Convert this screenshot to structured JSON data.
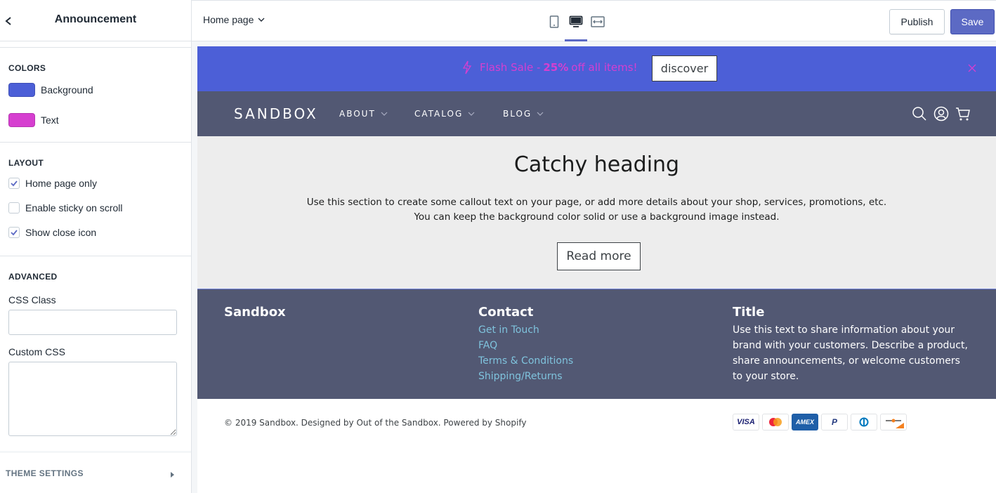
{
  "sidebar": {
    "title": "Announcement",
    "colors": {
      "heading": "COLORS",
      "items": [
        {
          "label": "Background",
          "color": "#4c5fd7"
        },
        {
          "label": "Text",
          "color": "#d63fd0"
        }
      ]
    },
    "layout": {
      "heading": "LAYOUT",
      "items": [
        {
          "label": "Home page only",
          "checked": true
        },
        {
          "label": "Enable sticky on scroll",
          "checked": false
        },
        {
          "label": "Show close icon",
          "checked": true
        }
      ]
    },
    "advanced": {
      "heading": "ADVANCED",
      "css_class_label": "CSS Class",
      "css_class_value": "",
      "custom_css_label": "Custom CSS",
      "custom_css_value": ""
    },
    "theme_settings_label": "THEME SETTINGS"
  },
  "topbar": {
    "page_select": "Home page",
    "devices": [
      "mobile-icon",
      "desktop-icon",
      "full-width-icon"
    ],
    "active_device": "desktop",
    "publish_label": "Publish",
    "save_label": "Save",
    "accent_color": "#5c6ac4"
  },
  "store": {
    "announcement": {
      "text_before": "Flash Sale - ",
      "highlight": "25%",
      "text_after": " off all items!",
      "button_label": "discover"
    },
    "nav": {
      "logo": "SANDBOX",
      "items": [
        "ABOUT",
        "CATALOG",
        "BLOG"
      ]
    },
    "hero": {
      "title": "Catchy heading",
      "line1": "Use this section to create some callout text on your page, or add more details about your shop, services, promotions, etc.",
      "line2": "You can keep the background color solid or use a background image instead.",
      "button_label": "Read more"
    },
    "footer": {
      "col1_title": "Sandbox",
      "col2_title": "Contact",
      "col2_links": [
        "Get in Touch",
        "FAQ",
        "Terms & Conditions",
        "Shipping/Returns"
      ],
      "col3_title": "Title",
      "col3_text": "Use this text to share information about your brand with your customers. Describe a product, share announcements, or welcome customers to your store."
    },
    "copyright": "© 2019 Sandbox. Designed by Out of the Sandbox. Powered by Shopify",
    "payments": [
      "VISA",
      "Mastercard",
      "AMEX",
      "PayPal",
      "Diners Club",
      "Discover"
    ]
  }
}
